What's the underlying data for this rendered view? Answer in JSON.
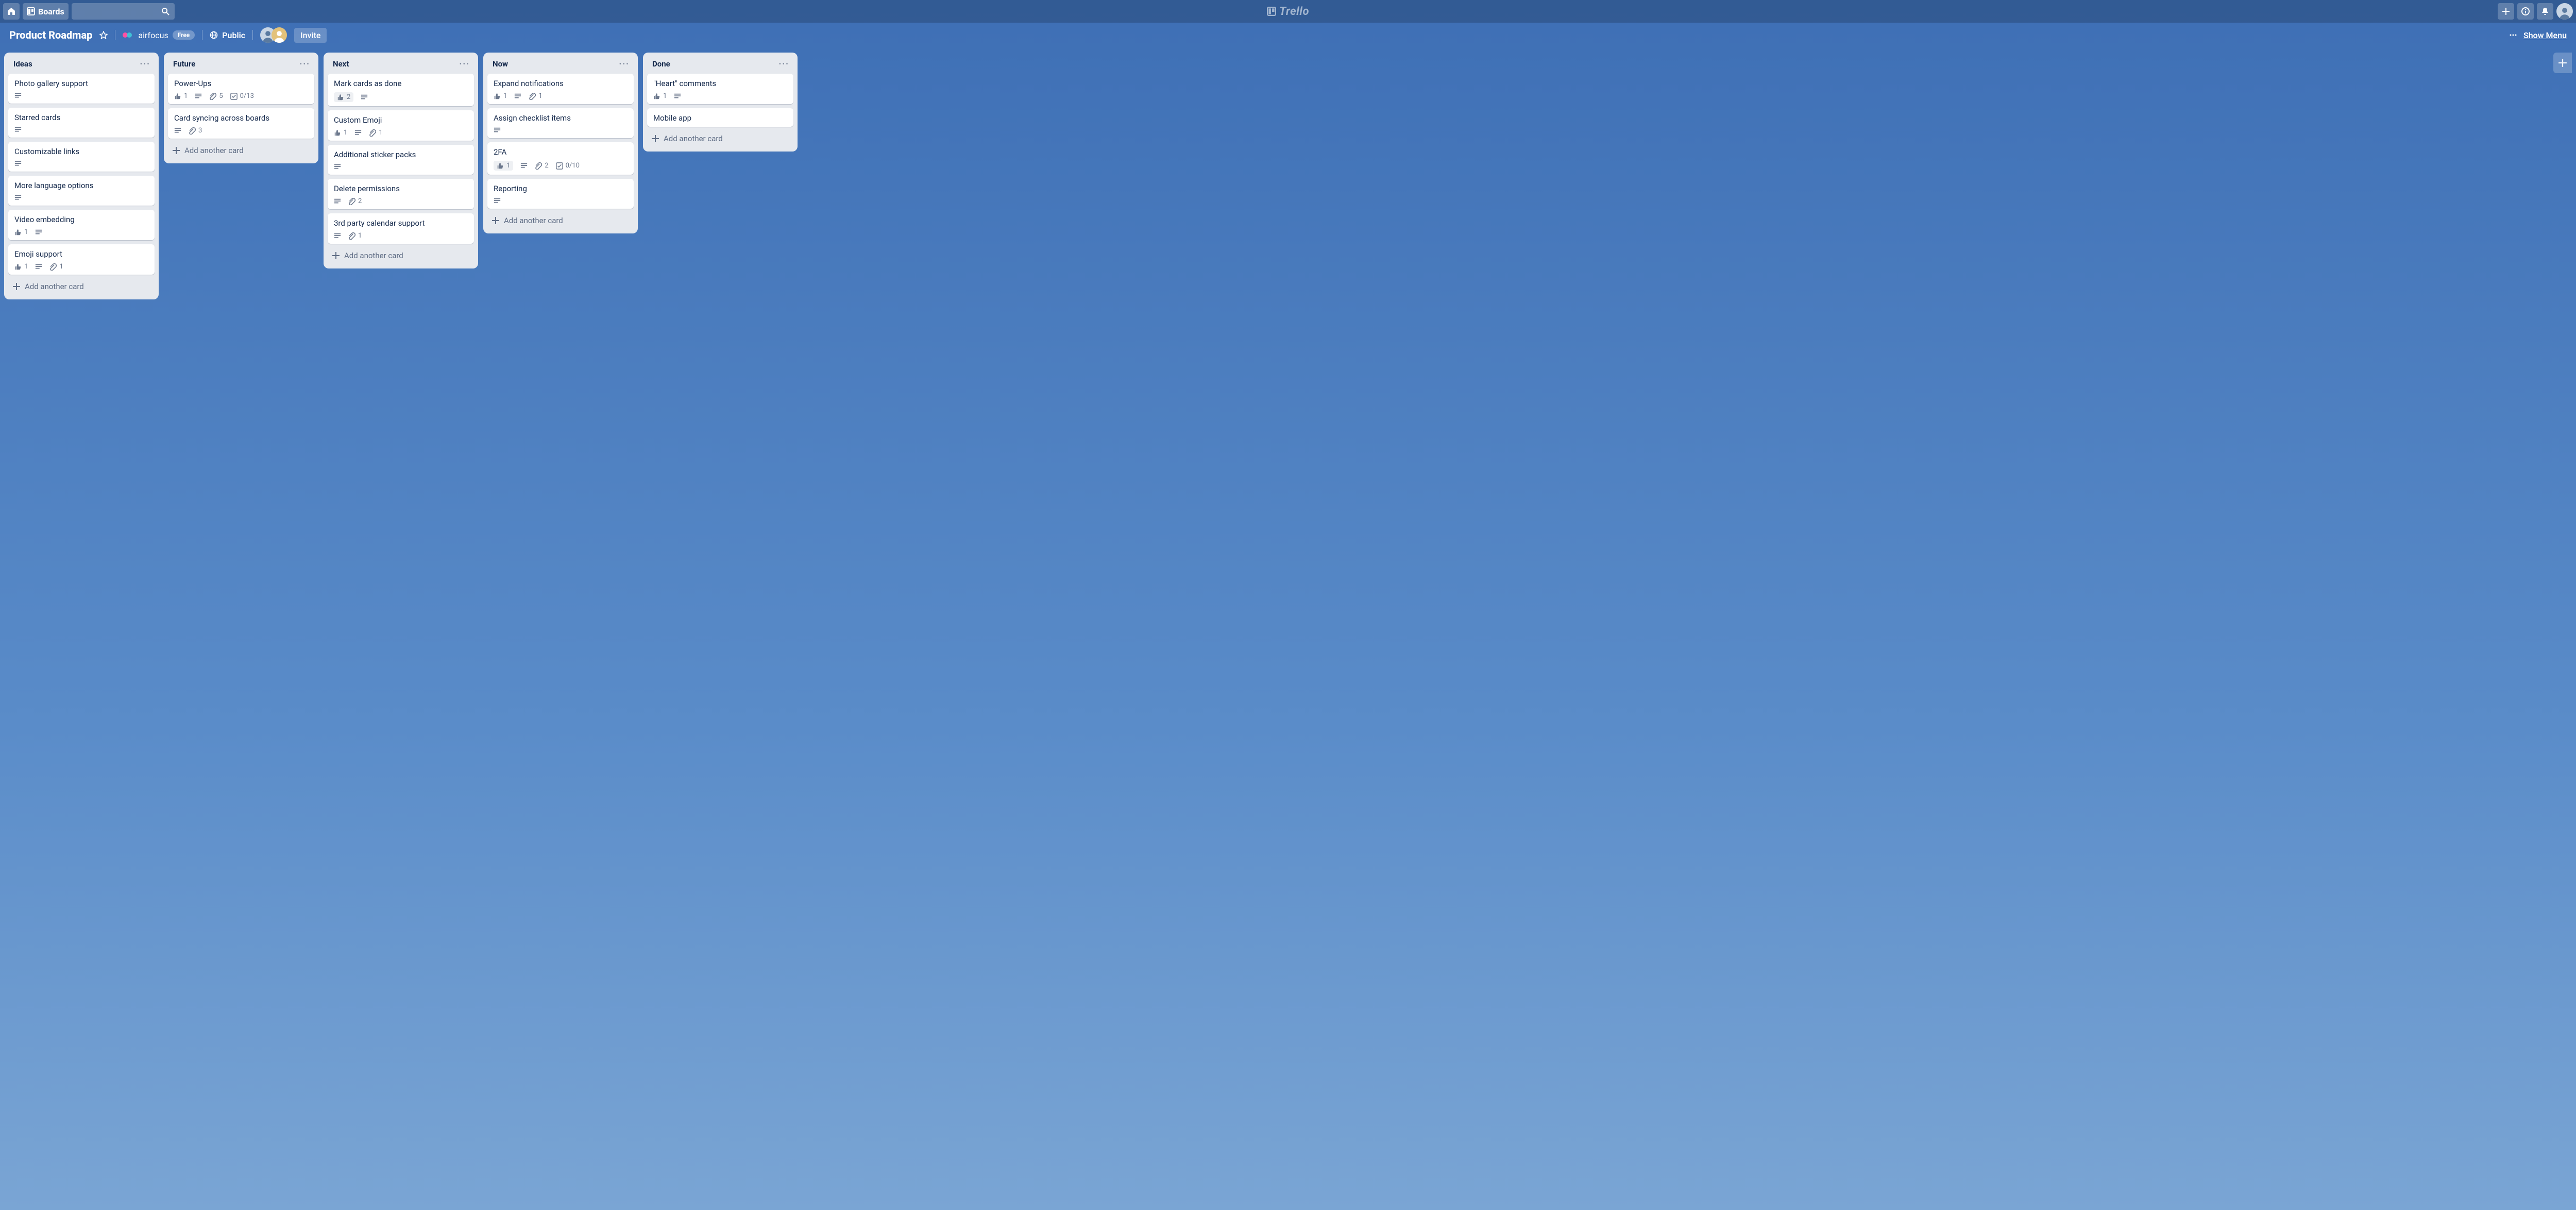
{
  "app": {
    "name": "Trello"
  },
  "topbar": {
    "boards_label": "Boards"
  },
  "board": {
    "title": "Product Roadmap",
    "team": "airfocus",
    "plan": "Free",
    "visibility": "Public",
    "invite_label": "Invite",
    "show_menu_label": "Show Menu",
    "add_card_label": "Add another card"
  },
  "lists": [
    {
      "title": "Ideas",
      "cards": [
        {
          "title": "Photo gallery support",
          "badges": {
            "desc": true
          }
        },
        {
          "title": "Starred cards",
          "badges": {
            "desc": true
          }
        },
        {
          "title": "Customizable links",
          "badges": {
            "desc": true
          }
        },
        {
          "title": "More language options",
          "badges": {
            "desc": true
          }
        },
        {
          "title": "Video embedding",
          "badges": {
            "votes": 1,
            "desc": true
          }
        },
        {
          "title": "Emoji support",
          "badges": {
            "votes": 1,
            "desc": true,
            "attachments": 1
          }
        }
      ]
    },
    {
      "title": "Future",
      "cards": [
        {
          "title": "Power-Ups",
          "badges": {
            "votes": 1,
            "desc": true,
            "attachments": 5,
            "checklist": "0/13"
          }
        },
        {
          "title": "Card syncing across boards",
          "badges": {
            "desc": true,
            "attachments": 3
          }
        }
      ]
    },
    {
      "title": "Next",
      "cards": [
        {
          "title": "Mark cards as done",
          "badges": {
            "votes": 2,
            "votes_boxed": true,
            "desc": true
          }
        },
        {
          "title": "Custom Emoji",
          "badges": {
            "votes": 1,
            "desc": true,
            "attachments": 1
          }
        },
        {
          "title": "Additional sticker packs",
          "badges": {
            "desc": true
          }
        },
        {
          "title": "Delete permissions",
          "badges": {
            "desc": true,
            "attachments": 2
          }
        },
        {
          "title": "3rd party calendar support",
          "badges": {
            "desc": true,
            "attachments": 1
          }
        }
      ]
    },
    {
      "title": "Now",
      "cards": [
        {
          "title": "Expand notifications",
          "badges": {
            "votes": 1,
            "desc": true,
            "attachments": 1
          }
        },
        {
          "title": "Assign checklist items",
          "badges": {
            "desc": true
          }
        },
        {
          "title": "2FA",
          "badges": {
            "votes": 1,
            "votes_boxed": true,
            "desc": true,
            "attachments": 2,
            "checklist": "0/10"
          }
        },
        {
          "title": "Reporting",
          "badges": {
            "desc": true
          }
        }
      ]
    },
    {
      "title": "Done",
      "cards": [
        {
          "title": "\"Heart\" comments",
          "badges": {
            "votes": 1,
            "desc": true
          }
        },
        {
          "title": "Mobile app",
          "badges": {}
        }
      ]
    }
  ]
}
